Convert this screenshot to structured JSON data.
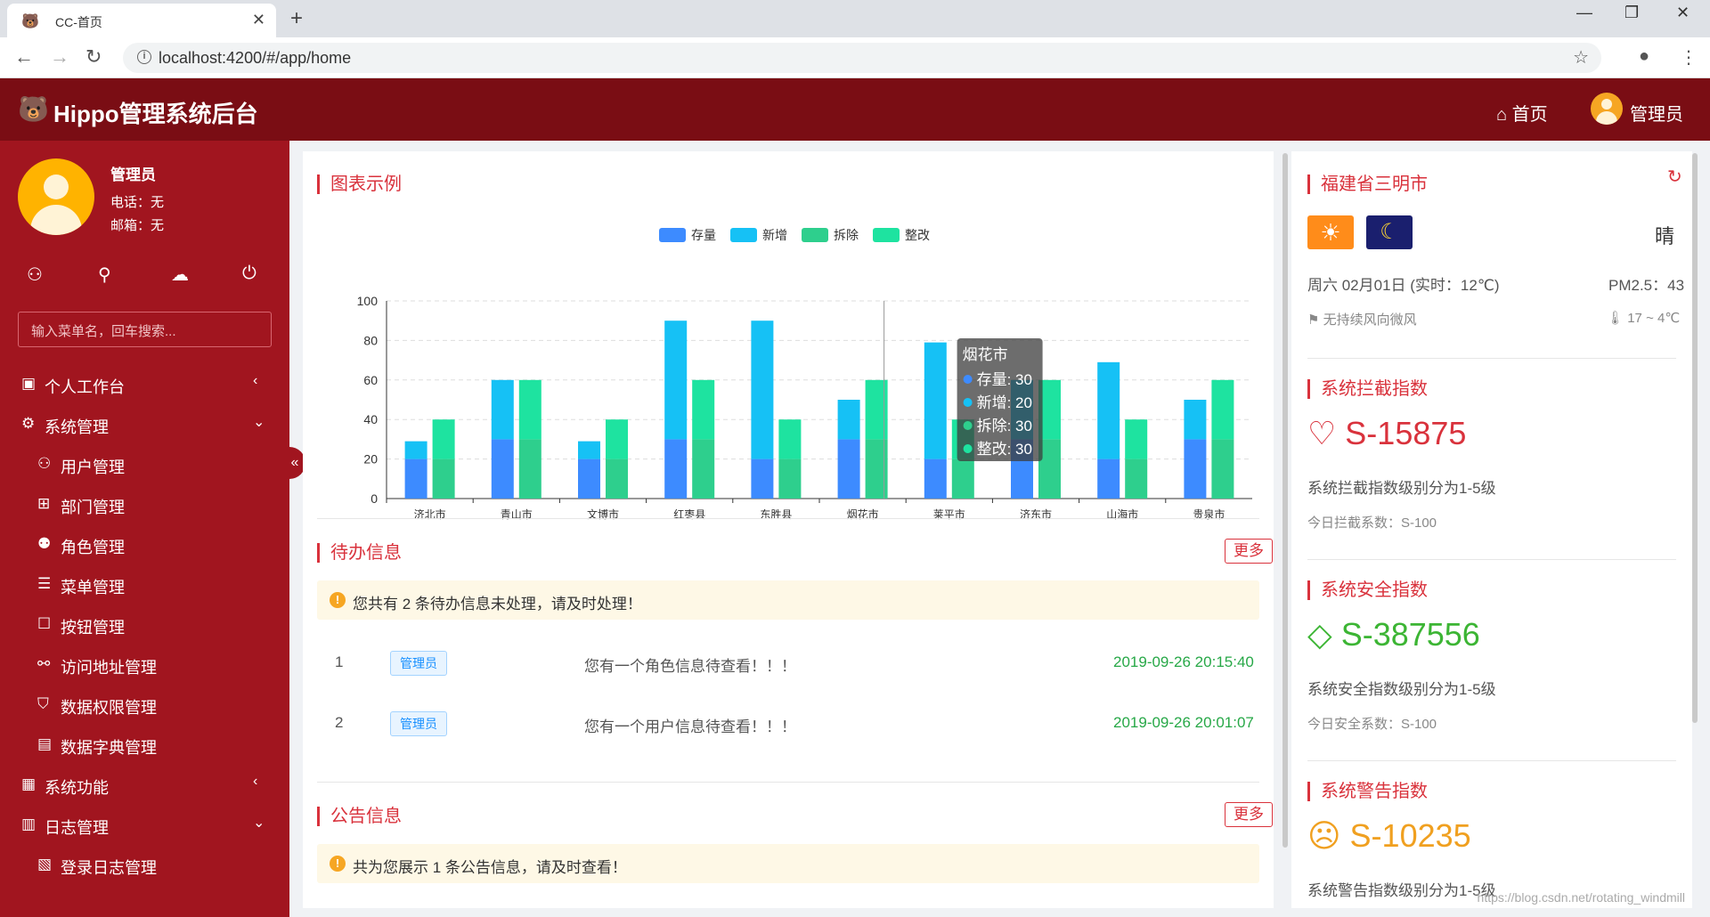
{
  "browser": {
    "tab_title": "CC-首页",
    "url": "localhost:4200/#/app/home"
  },
  "header": {
    "app_title": "Hippo管理系统后台",
    "home_label": "首页",
    "user_label": "管理员"
  },
  "sidebar": {
    "profile_name": "管理员",
    "phone": "电话：无",
    "email": "邮箱：无",
    "search_placeholder": "输入菜单名，回车搜索...",
    "menu": [
      {
        "label": "个人工作台",
        "icon": "dashboard-icon",
        "arrow": "‹"
      },
      {
        "label": "系统管理",
        "icon": "settings-icon",
        "arrow": "⌄"
      },
      {
        "label": "用户管理",
        "icon": "user-icon"
      },
      {
        "label": "部门管理",
        "icon": "org-icon"
      },
      {
        "label": "角色管理",
        "icon": "role-icon"
      },
      {
        "label": "菜单管理",
        "icon": "menu-icon"
      },
      {
        "label": "按钮管理",
        "icon": "button-icon"
      },
      {
        "label": "访问地址管理",
        "icon": "link-icon"
      },
      {
        "label": "数据权限管理",
        "icon": "shield-icon"
      },
      {
        "label": "数据字典管理",
        "icon": "book-icon"
      },
      {
        "label": "系统功能",
        "icon": "grid-icon",
        "arrow": "‹"
      },
      {
        "label": "日志管理",
        "icon": "log-icon",
        "arrow": "⌄"
      },
      {
        "label": "登录日志管理",
        "icon": "calendar-icon"
      }
    ]
  },
  "chart_section": {
    "title": "图表示例"
  },
  "chart_data": {
    "type": "bar",
    "categories": [
      "济北市",
      "青山市",
      "文博市",
      "红枣县",
      "东胜县",
      "烟花市",
      "莱平市",
      "济东市",
      "山海市",
      "贵泉市"
    ],
    "series": [
      {
        "name": "存量",
        "stack": "A",
        "color": "#3d8bff",
        "values": [
          20,
          30,
          20,
          30,
          20,
          30,
          20,
          30,
          20,
          30
        ]
      },
      {
        "name": "新增",
        "stack": "A",
        "color": "#16c1f5",
        "values": [
          9,
          30,
          9,
          60,
          70,
          20,
          59,
          30,
          49,
          20
        ]
      },
      {
        "name": "拆除",
        "stack": "B",
        "color": "#2ecf8d",
        "values": [
          20,
          30,
          20,
          30,
          20,
          30,
          20,
          30,
          20,
          30
        ]
      },
      {
        "name": "整改",
        "stack": "B",
        "color": "#1ee3a0",
        "values": [
          20,
          30,
          20,
          30,
          20,
          30,
          20,
          30,
          20,
          30
        ]
      }
    ],
    "ylim": [
      0,
      100
    ],
    "yticks": [
      0,
      20,
      40,
      60,
      80,
      100
    ],
    "grid": true,
    "legend": "top-center",
    "tooltip": {
      "title": "烟花市",
      "lines": [
        "存量: 30",
        "新增: 20",
        "拆除: 30",
        "整改: 30"
      ]
    }
  },
  "todo": {
    "title": "待办信息",
    "more": "更多",
    "alert": "您共有 2 条待办信息未处理，请及时处理！",
    "rows": [
      {
        "index": "1",
        "tag": "管理员",
        "message": "您有一个角色信息待查看！！！",
        "time": "2019-09-26 20:15:40"
      },
      {
        "index": "2",
        "tag": "管理员",
        "message": "您有一个用户信息待查看！！！",
        "time": "2019-09-26 20:01:07"
      }
    ]
  },
  "notice": {
    "title": "公告信息",
    "more": "更多",
    "alert": "共为您展示 1 条公告信息，请及时查看！"
  },
  "weather": {
    "city": "福建省三明市",
    "condition": "晴",
    "date": "周六 02月01日 (实时：12℃)",
    "pm25": "PM2.5：43",
    "wind": "无持续风向微风",
    "temp_range": "17 ~ 4℃"
  },
  "indices": [
    {
      "title": "系统拦截指数",
      "value": "S-15875",
      "desc": "系统拦截指数级别分为1-5级",
      "sub": "今日拦截系数：S-100",
      "color": "#d9323c"
    },
    {
      "title": "系统安全指数",
      "value": "S-387556",
      "desc": "系统安全指数级别分为1-5级",
      "sub": "今日安全系数：S-100",
      "color": "#3cb534"
    },
    {
      "title": "系统警告指数",
      "value": "S-10235",
      "desc": "系统警告指数级别分为1-5级",
      "color": "#f0a020"
    }
  ],
  "footer_watermark": "https://blog.csdn.net/rotating_windmill",
  "colors": {
    "brand_dark": "#7a0d14",
    "sidebar": "#a1151f",
    "accent": "#d9323c"
  }
}
